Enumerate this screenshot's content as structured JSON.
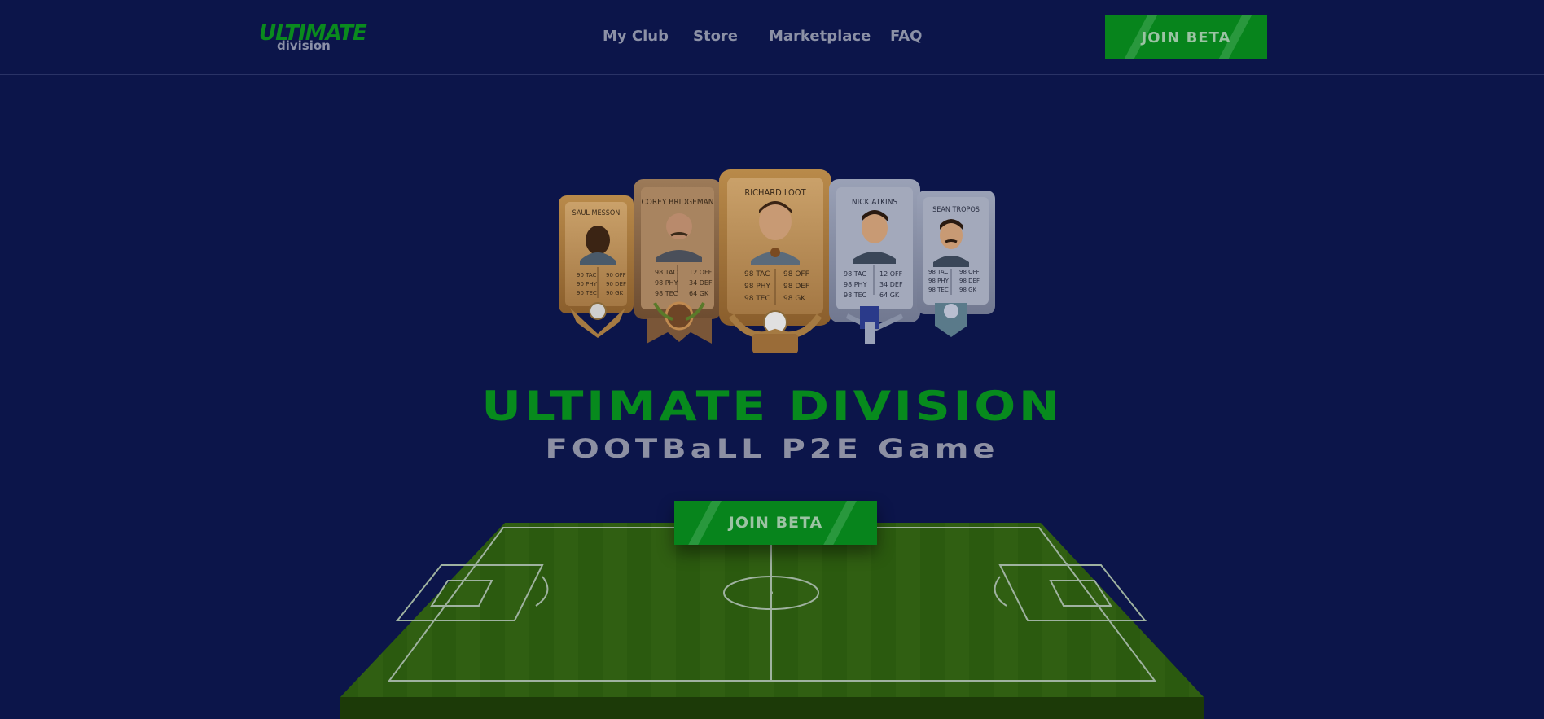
{
  "header": {
    "logo_top": "ULTIMATE",
    "logo_bottom": "division",
    "nav": [
      "My Club",
      "Store",
      "Marketplace",
      "FAQ"
    ],
    "join_label": "JOIN BETA"
  },
  "hero": {
    "title": "ULTIMATE DIVISION",
    "subtitle": "FOOTBaLL P2E Game",
    "join_label": "JOIN BETA"
  },
  "cards": [
    {
      "name": "SAUL MESSON",
      "stats_left": [
        "90 TAC",
        "90 PHY",
        "90 TEC"
      ],
      "stats_right": [
        "90 OFF",
        "90 DEF",
        "90 GK"
      ],
      "tier": "gold"
    },
    {
      "name": "COREY BRIDGEMAN",
      "stats_left": [
        "98 TAC",
        "98 PHY",
        "98 TEC"
      ],
      "stats_right": [
        "12 OFF",
        "34 DEF",
        "64 GK"
      ],
      "tier": "bronze"
    },
    {
      "name": "RICHARD LOOT",
      "stats_left": [
        "98 TAC",
        "98 PHY",
        "98 TEC"
      ],
      "stats_right": [
        "98 OFF",
        "98 DEF",
        "98 GK"
      ],
      "tier": "gold"
    },
    {
      "name": "NICK ATKINS",
      "stats_left": [
        "98 TAC",
        "98 PHY",
        "98 TEC"
      ],
      "stats_right": [
        "12 OFF",
        "34 DEF",
        "64 GK"
      ],
      "tier": "silver"
    },
    {
      "name": "SEAN TROPOS",
      "stats_left": [
        "98 TAC",
        "98 PHY",
        "98 TEC"
      ],
      "stats_right": [
        "98 OFF",
        "98 DEF",
        "98 GK"
      ],
      "tier": "silver"
    }
  ],
  "colors": {
    "background": "#0c154a",
    "accent_green": "#078a1d",
    "nav_text": "#8c91a6"
  }
}
